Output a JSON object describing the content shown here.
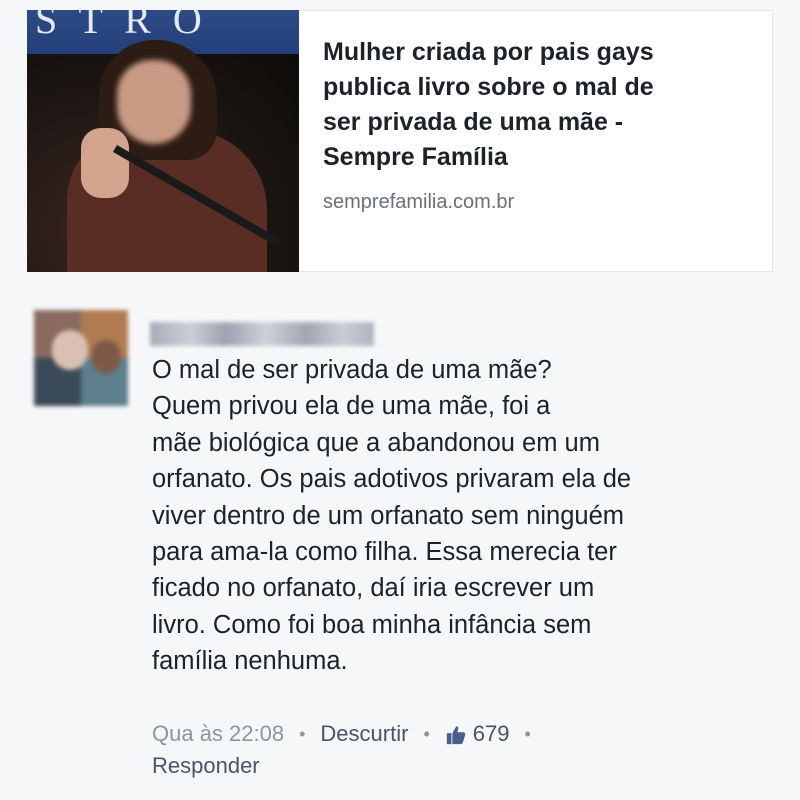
{
  "link_preview": {
    "title_lines": [
      "Mulher criada por pais gays",
      "publica livro sobre o mal de",
      "ser privada de uma mãe -",
      "Sempre Família"
    ],
    "domain": "semprefamilia.com.br"
  },
  "comment": {
    "lines": [
      "O mal de ser privada de uma mãe?",
      "Quem privou ela de uma mãe, foi a",
      "mãe biológica que a abandonou em um",
      "orfanato. Os pais adotivos privaram ela de",
      "viver dentro de um orfanato sem ninguém",
      "para ama-la como filha. Essa merecia ter",
      "ficado no orfanato, daí iria escrever um",
      "livro. Como foi boa minha infância sem",
      "família nenhuma."
    ],
    "timestamp": "Qua às 22:08",
    "unlike_label": "Descurtir",
    "like_count": "679",
    "reply_label": "Responder",
    "separator": "•",
    "like_icon": "thumbs-up-icon"
  },
  "colors": {
    "like_blue": "#4a5f8f",
    "text": "#1d2129",
    "muted": "#90949c"
  }
}
